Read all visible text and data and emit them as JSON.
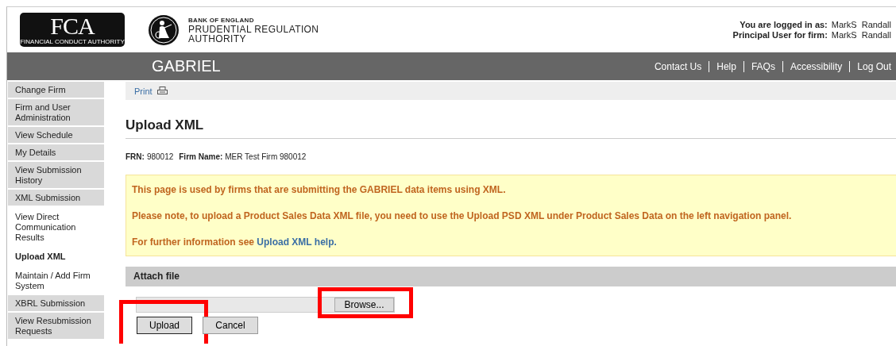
{
  "header": {
    "fca_logo": {
      "letters": "FCA",
      "caption": "FINANCIAL CONDUCT AUTHORITY"
    },
    "pra_logo": {
      "line_1": "BANK OF ENGLAND",
      "line_2": "PRUDENTIAL REGULATION",
      "line_3": "AUTHORITY"
    },
    "user_info": [
      {
        "label": "You are logged in as:",
        "value": "MarkS  Randall"
      },
      {
        "label": "Principal User for firm:",
        "value": "MarkS  Randall"
      }
    ]
  },
  "nav_bar": {
    "title": "GABRIEL",
    "links": [
      "Contact Us",
      "Help",
      "FAQs",
      "Accessibility",
      "Log Out"
    ]
  },
  "sidebar": {
    "items": [
      {
        "label": "Change Firm",
        "kind": "section",
        "selected": false
      },
      {
        "label": "Firm and User Administration",
        "kind": "section",
        "selected": false
      },
      {
        "label": "View Schedule",
        "kind": "section",
        "selected": false
      },
      {
        "label": "My Details",
        "kind": "section",
        "selected": false
      },
      {
        "label": "View Submission History",
        "kind": "section",
        "selected": false
      },
      {
        "label": "XML Submission",
        "kind": "section",
        "selected": false
      },
      {
        "label": "View Direct Communication Results",
        "kind": "sub",
        "selected": false
      },
      {
        "label": "Upload XML",
        "kind": "sub",
        "selected": true
      },
      {
        "label": "Maintain / Add Firm System",
        "kind": "sub",
        "selected": false
      },
      {
        "label": "XBRL Submission",
        "kind": "section",
        "selected": false
      },
      {
        "label": "View Resubmission Requests",
        "kind": "section",
        "selected": false
      }
    ]
  },
  "toolbar": {
    "print": "Print"
  },
  "page": {
    "title": "Upload XML",
    "firm_info": [
      {
        "label": "FRN:",
        "value": "980012"
      },
      {
        "label": "Firm Name:",
        "value": "MER Test Firm 980012"
      }
    ],
    "notice": {
      "lines": [
        "This page is used by firms that are submitting the GABRIEL data items using XML.",
        "Please note, to upload a Product Sales Data XML file, you need to use the Upload PSD XML under Product Sales Data on the left navigation panel."
      ],
      "help_prefix": "For further information see",
      "help_link": "Upload XML help."
    }
  },
  "attach": {
    "title": "Attach file",
    "browse": {
      "label": "Browse...",
      "highlighted": true
    },
    "upload": {
      "label": "Upload",
      "highlighted": true
    },
    "cancel": {
      "label": "Cancel"
    }
  }
}
